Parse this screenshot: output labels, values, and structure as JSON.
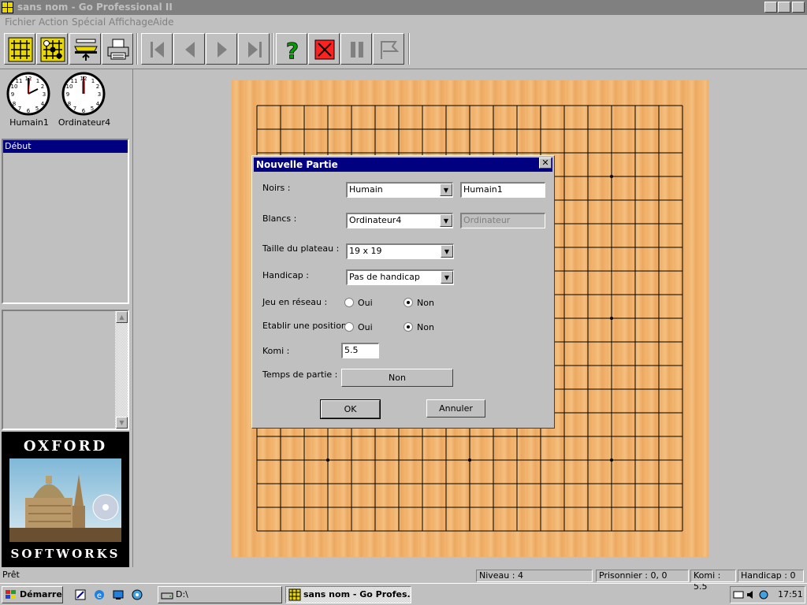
{
  "window": {
    "title": "sans nom - Go Professional II"
  },
  "menu": [
    "Fichier",
    "Action",
    "Spécial",
    "Affichage",
    "Aide"
  ],
  "toolbar": {
    "icons": [
      "new-game-icon",
      "setup-board-icon",
      "load-icon",
      "print-icon",
      "first-move-icon",
      "prev-move-icon",
      "next-move-icon",
      "last-move-icon",
      "hint-icon",
      "resign-icon",
      "pause-icon",
      "pass-icon"
    ]
  },
  "players": [
    {
      "name": "Humain1"
    },
    {
      "name": "Ordinateur4"
    }
  ],
  "movelist": {
    "selected": "Début"
  },
  "logo": {
    "top": "OXFORD",
    "bottom": "SOFTWORKS"
  },
  "dialog": {
    "title": "Nouvelle Partie",
    "noirs_label": "Noirs :",
    "noirs_type": "Humain",
    "noirs_name": "Humain1",
    "blancs_label": "Blancs :",
    "blancs_type": "Ordinateur4",
    "blancs_name": "Ordinateur",
    "taille_label": "Taille du plateau :",
    "taille_value": "19 x 19",
    "handicap_label": "Handicap :",
    "handicap_value": "Pas de handicap",
    "reseau_label": "Jeu en réseau :",
    "position_label": "Etablir une position :",
    "oui": "Oui",
    "non": "Non",
    "komi_label": "Komi :",
    "komi_value": "5.5",
    "temps_label": "Temps de partie :",
    "temps_button": "Non",
    "ok": "OK",
    "annuler": "Annuler"
  },
  "statusbar": {
    "ready": "Prêt",
    "niveau": "Niveau : 4",
    "prisonnier": "Prisonnier : 0, 0",
    "komi": "Komi : 5.5",
    "handicap": "Handicap : 0"
  },
  "taskbar": {
    "start": "Démarrer",
    "tasks": [
      "D:\\",
      "sans nom - Go Profes..."
    ],
    "clock": "17:51"
  },
  "board": {
    "size": 19
  }
}
